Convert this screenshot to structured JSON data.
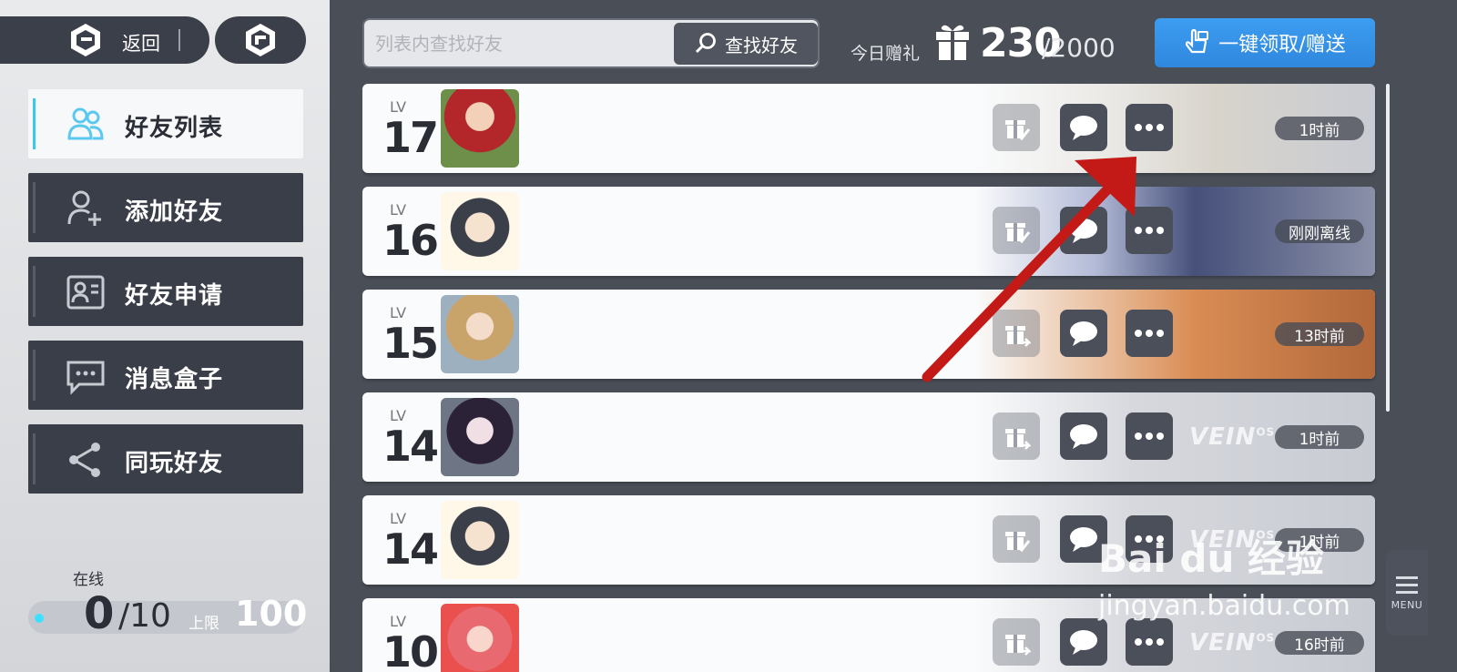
{
  "header": {
    "back_label": "返回",
    "search_placeholder": "列表内查找好友",
    "search_button": "查找好友",
    "gift_label": "今日赠礼",
    "gift_count": "230",
    "gift_total": "/2000",
    "claim_button": "一键领取/赠送"
  },
  "sidebar": {
    "items": [
      {
        "label": "好友列表",
        "icon": "friends-icon",
        "active": true
      },
      {
        "label": "添加好友",
        "icon": "add-friend-icon",
        "active": false
      },
      {
        "label": "好友申请",
        "icon": "friend-request-icon",
        "active": false
      },
      {
        "label": "消息盒子",
        "icon": "message-icon",
        "active": false
      },
      {
        "label": "同玩好友",
        "icon": "share-icon",
        "active": false
      }
    ],
    "online_title": "在线",
    "online_count": "0",
    "online_max": "/10",
    "limit_label": "上限",
    "limit_value": "100"
  },
  "friends": [
    {
      "lv_label": "LV",
      "level": "17",
      "status": "1时前",
      "gift_state": "received"
    },
    {
      "lv_label": "LV",
      "level": "16",
      "status": "刚刚离线",
      "gift_state": "received"
    },
    {
      "lv_label": "LV",
      "level": "15",
      "status": "13时前",
      "gift_state": "send"
    },
    {
      "lv_label": "LV",
      "level": "14",
      "status": "1时前",
      "gift_state": "send",
      "brand": "VEIN",
      "brand_sup": "OS"
    },
    {
      "lv_label": "LV",
      "level": "14",
      "status": "1时前",
      "gift_state": "received",
      "brand": "VEIN",
      "brand_sup": "OS"
    },
    {
      "lv_label": "LV",
      "level": "10",
      "status": "16时前",
      "gift_state": "send",
      "brand": "VEIN",
      "brand_sup": "OS"
    }
  ],
  "menu_label": "MENU",
  "watermark": {
    "line1": "Bai du 经验",
    "line2": "jingyan.baidu.com"
  },
  "colors": {
    "accent": "#3cc7ee",
    "primary_button": "#3d9df0",
    "annotation_arrow": "#c41a17"
  }
}
